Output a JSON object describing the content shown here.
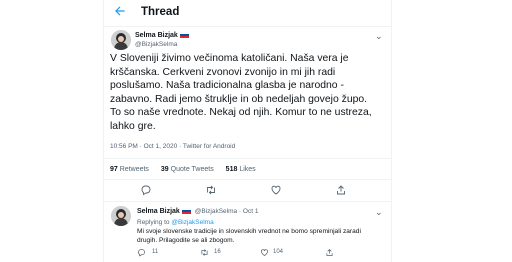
{
  "header": {
    "title": "Thread"
  },
  "tweet": {
    "name": "Selma Bizjak",
    "handle": "@BizjakSelma",
    "text": "V Sloveniji živimo večinoma katoličani. Naša vera je\nkrščanska. Cerkveni zvonovi zvonijo in mi jih radi\nposlušamo. Naša tradicionalna glasba je narodno -\nzabavno. Radi jemo štruklje in ob nedeljah govejo župo.\nTo so naše vrednote. Nekaj od njih. Komur to ne ustreza,\nlahko gre.",
    "meta": "10:56 PM · Oct 1, 2020 · Twitter for Android",
    "retweets_count": "97",
    "retweets_label": "Retweets",
    "quotes_count": "39",
    "quotes_label": "Quote Tweets",
    "likes_count": "518",
    "likes_label": "Likes"
  },
  "reply": {
    "name": "Selma Bizjak",
    "handle_date": "@BizjakSelma · Oct 1",
    "replying_label": "Replying to",
    "replying_handle": "@BizjakSelma",
    "text": "Mi svoje slovenske tradicije in slovenskih vrednot ne bomo spreminjali zaradi drugih. Prilagodite se ali zbogom.",
    "reply_count": "11",
    "retweet_count": "16",
    "like_count": "104"
  },
  "colors": {
    "accent": "#1d9bf0",
    "muted": "#536471"
  },
  "icons": [
    "back-arrow-icon",
    "chevron-down-icon",
    "reply-icon",
    "retweet-icon",
    "like-icon",
    "share-icon",
    "slovenia-flag-icon"
  ]
}
